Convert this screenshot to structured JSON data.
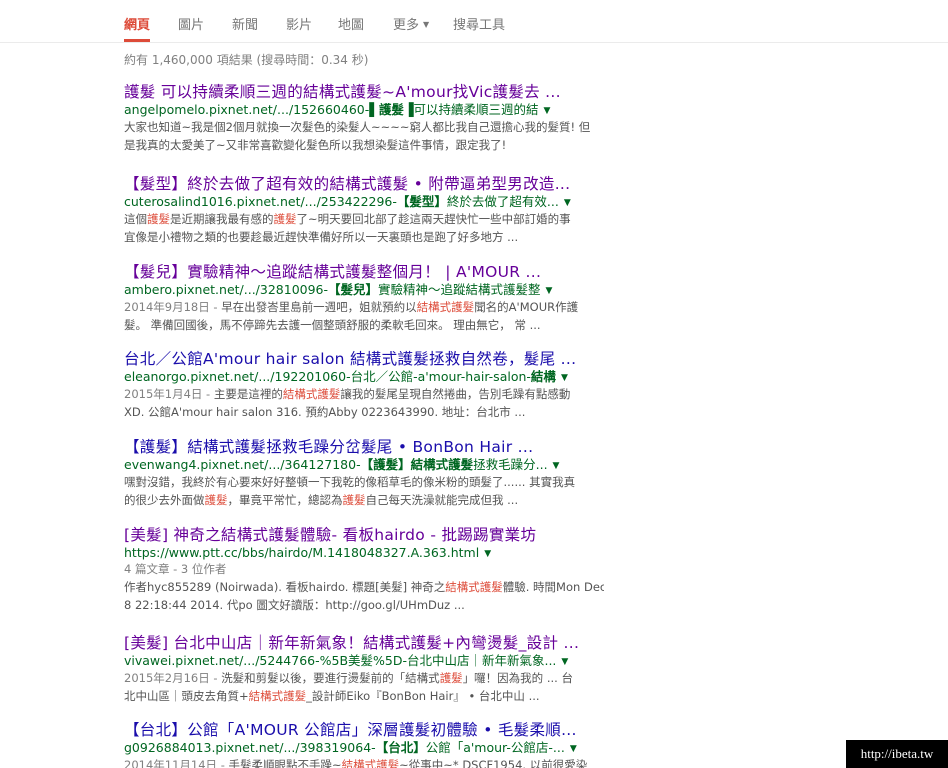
{
  "tabs": [
    {
      "label": "網頁",
      "active": true
    },
    {
      "label": "圖片"
    },
    {
      "label": "新聞"
    },
    {
      "label": "影片"
    },
    {
      "label": "地圖"
    },
    {
      "label": "更多"
    },
    {
      "label": "搜尋工具"
    }
  ],
  "stats": "約有 1,460,000 項結果 (搜尋時間：0.34 秒)",
  "results": [
    {
      "title": "護髮 可以持續柔順三週的結構式護髮~A'mour找Vic護髮去 ...",
      "visited": true,
      "url_pre": "angelpomelo.pixnet.net/.../152660460-",
      "url_bold": "▌護髮▐",
      "url_post": "可以持續柔順三週的結",
      "snippet_date": "",
      "snippet": [
        [
          {
            "t": "大家也知道~我是個2個月就換一次髮色的染髮人~~~~窮人都比我自己還擔心我的髮質! 但"
          }
        ],
        [
          {
            "t": "是我真的太愛美了~又非常喜歡變化髮色所以我想染髮這件事情，跟定我了!"
          }
        ]
      ]
    },
    {
      "title": "【髮型】終於去做了超有效的結構式護髮 • 附帶逼弟型男改造...",
      "visited": true,
      "url_pre": "cuterosalind1016.pixnet.net/.../253422296-",
      "url_bold": "【髮型】",
      "url_post": "終於去做了超有效...",
      "snippet_date": "",
      "snippet": [
        [
          {
            "t": "這個"
          },
          {
            "t": "護髮",
            "hl": true
          },
          {
            "t": "是近期讓我最有感的"
          },
          {
            "t": "護髮",
            "hl": true
          },
          {
            "t": "了~明天要回北部了趁這兩天趕快忙一些中部訂婚的事"
          }
        ],
        [
          {
            "t": "宜像是小禮物之類的也要趁最近趕快準備好所以一天裏頭也是跑了好多地方 ..."
          }
        ]
      ]
    },
    {
      "title": "【髮兒】實驗精神～追蹤結構式護髮整個月！ | A'MOUR ...",
      "visited": true,
      "url_pre": "ambero.pixnet.net/.../32810096-",
      "url_bold": "【髮兒】",
      "url_post": "實驗精神～追蹤結構式護髮整",
      "snippet_date": "2014年9月18日 - ",
      "snippet": [
        [
          {
            "t": "早在出發峇里島前一週吧，姐就預約以"
          },
          {
            "t": "結構式護髮",
            "hl": true
          },
          {
            "t": "聞名的A'MOUR作護"
          }
        ],
        [
          {
            "t": "髮。 準備回國後，馬不停蹄先去護一個整頭舒服的柔軟毛回來。 理由無它， 常 ..."
          }
        ]
      ]
    },
    {
      "title": "台北／公館A'mour hair salon 結構式護髮拯救自然卷，髮尾 ...",
      "visited": false,
      "url_pre": "eleanorgo.pixnet.net/.../192201060-台北／公館-a'mour-hair-salon-",
      "url_bold": "結構",
      "url_post": "",
      "snippet_date": "2015年1月4日 - ",
      "snippet": [
        [
          {
            "t": "主要是這裡的"
          },
          {
            "t": "結構式護髮",
            "hl": true
          },
          {
            "t": "讓我的髮尾呈現自然捲曲，告別毛躁有點感動"
          }
        ],
        [
          {
            "t": "XD. 公館A'mour hair salon 316. 預約Abby 0223643990. 地址：台北市 ..."
          }
        ]
      ]
    },
    {
      "title": "【護髮】結構式護髮拯救毛躁分岔髮尾 • BonBon Hair ...",
      "visited": false,
      "url_pre": "evenwang4.pixnet.net/.../364127180-",
      "url_bold": "【護髮】結構式護髮",
      "url_post": "拯救毛躁分...",
      "snippet_date": "",
      "snippet": [
        [
          {
            "t": "嘿對沒錯，我終於有心要來好好整頓一下我乾的像稻草毛的像米粉的頭髮了...... 其實我真"
          }
        ],
        [
          {
            "t": "的很少去外面做"
          },
          {
            "t": "護髮",
            "hl": true
          },
          {
            "t": "，畢竟平常忙，總認為"
          },
          {
            "t": "護髮",
            "hl": true
          },
          {
            "t": "自己每天洗澡就能完成但我 ..."
          }
        ]
      ]
    },
    {
      "title": "[美髮] 神奇之結構式護髮體驗- 看板hairdo - 批踢踢實業坊",
      "visited": true,
      "url_pre": "https://www.ptt.cc/bbs/hairdo/M.1418048327.A.363.html",
      "url_bold": "",
      "url_post": "",
      "meta": "4 篇文章 - 3 位作者",
      "snippet_date": "",
      "snippet": [
        [
          {
            "t": "作者hyc855289 (Noirwada). 看板hairdo. 標題[美髮] 神奇之"
          },
          {
            "t": "結構式護髮",
            "hl": true
          },
          {
            "t": "體驗. 時間Mon Dec"
          }
        ],
        [
          {
            "t": "8 22:18:44 2014. 代po 圖文好讀版：http://goo.gl/UHmDuz ..."
          }
        ]
      ]
    },
    {
      "title": "[美髮] 台北中山店｜新年新氣象！結構式護髮+內彎燙髮_設計 ...",
      "visited": true,
      "url_pre": "vivawei.pixnet.net/.../5244766-%5B美髮%5D-台北中山店｜新年新氣象...",
      "url_bold": "",
      "url_post": "",
      "snippet_date": "2015年2月16日 - ",
      "snippet": [
        [
          {
            "t": "洗髮和剪髮以後，要進行燙髮前的「結構式"
          },
          {
            "t": "護髮",
            "hl": true
          },
          {
            "t": "」囉！因為我的 ... 台"
          }
        ],
        [
          {
            "t": "北中山區｜頭皮去角質+"
          },
          {
            "t": "結構式護髮",
            "hl": true
          },
          {
            "t": "_設計師Eiko『BonBon Hair』 • 台北中山 ..."
          }
        ]
      ]
    },
    {
      "title": "【台北】公館「A'MOUR 公館店」深層護髮初體驗 • 毛髮柔順...",
      "visited": false,
      "url_pre": "g0926884013.pixnet.net/.../398319064-",
      "url_bold": "【台北】",
      "url_post": "公館「a'mour-公館店-...",
      "snippet_date": "2014年11月14日 - ",
      "snippet": [
        [
          {
            "t": "手髮柔順眼點不手躁~"
          },
          {
            "t": "結構式護髮",
            "hl": true
          },
          {
            "t": "~從事中~* DSCF1954. 以前很愛染"
          }
        ],
        [
          {
            "t": ""
          }
        ]
      ]
    }
  ],
  "watermark": "http://ibeta.tw"
}
